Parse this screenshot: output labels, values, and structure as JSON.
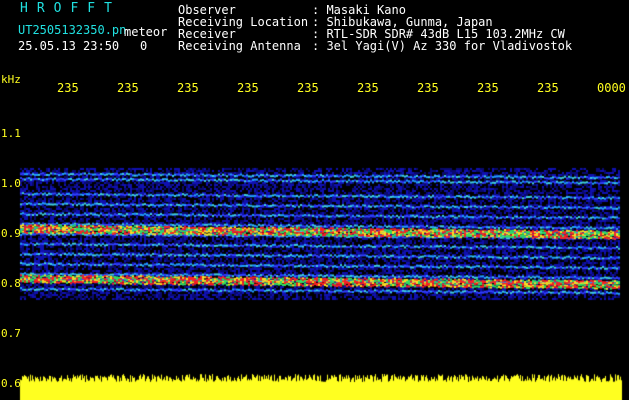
{
  "header": {
    "brand": "HROFFT",
    "file_name": "UT2505132350.pn",
    "meteor_label": "meteor",
    "timestamp": "25.05.13 23:50",
    "count": "0",
    "info": [
      {
        "label": "Observer",
        "value": ": Masaki Kano"
      },
      {
        "label": "Receiving Location",
        "value": ": Shibukawa, Gunma, Japan"
      },
      {
        "label": "Receiver",
        "value": ": RTL-SDR SDR# 43dB L15 103.2MHz CW"
      },
      {
        "label": "Receiving Antenna",
        "value": ": 3el Yagi(V) Az 330 for Vladivostok"
      }
    ]
  },
  "axis": {
    "unit": "kHz",
    "y_ticks": [
      "1.1",
      "1.0",
      "0.9",
      "0.8",
      "0.7",
      "0.6"
    ],
    "x_ticks": [
      "235",
      "235",
      "235",
      "235",
      "235",
      "235",
      "235",
      "235",
      "235",
      "0000"
    ]
  },
  "chart_data": {
    "type": "heatmap",
    "ylabel": "kHz",
    "ylim": [
      0.6,
      1.15
    ],
    "bands_khz": [
      1.01,
      1.0,
      0.97,
      0.95,
      0.93,
      0.91,
      0.9,
      0.89,
      0.87,
      0.85,
      0.83,
      0.81,
      0.8,
      0.78
    ],
    "strong_bands_khz": [
      0.9,
      0.8
    ],
    "colors": {
      "background": "#000000",
      "noise": "#0a0aa0",
      "band": "#3fd0e0",
      "strong": "#ff2020",
      "tick": "#ffff20",
      "header_cyan": "#20e0e0"
    }
  }
}
